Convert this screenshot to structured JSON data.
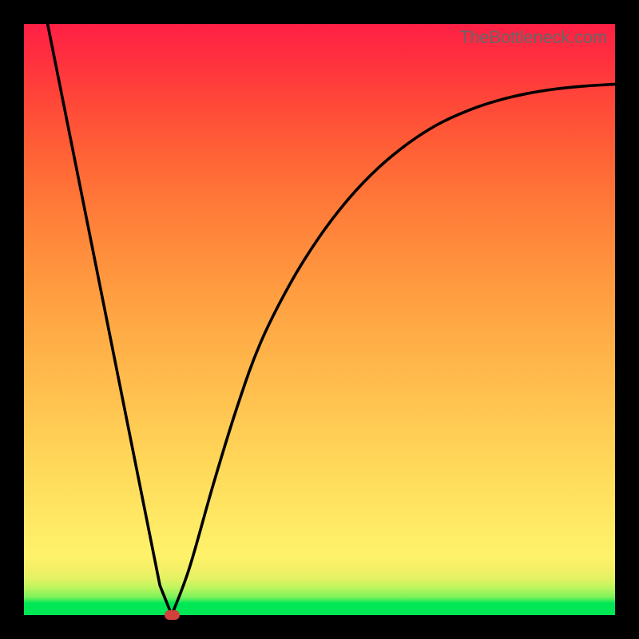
{
  "watermark": {
    "text": "TheBottleneck.com"
  },
  "colors": {
    "background": "#000000",
    "gradient_bottom": "#00e756",
    "gradient_top": "#ff2045",
    "curve_stroke": "#000000",
    "dot_fill": "#d1413e",
    "watermark_text": "#666666"
  },
  "chart_data": {
    "type": "line",
    "title": "",
    "xlabel": "",
    "ylabel": "",
    "xlim": [
      0,
      100
    ],
    "ylim": [
      0,
      100
    ],
    "annotations": [
      "TheBottleneck.com"
    ],
    "series": [
      {
        "name": "bottleneck-curve",
        "x": [
          4,
          8,
          12,
          16,
          20,
          23,
          25,
          28,
          32,
          36,
          40,
          45,
          50,
          55,
          60,
          65,
          70,
          75,
          80,
          85,
          90,
          95,
          100
        ],
        "values": [
          100,
          80,
          60,
          40,
          20,
          5,
          0,
          8,
          22,
          35,
          46,
          56,
          64,
          70.5,
          75.7,
          79.8,
          83,
          85.3,
          87,
          88.2,
          89,
          89.5,
          89.8
        ]
      }
    ],
    "minimum_point": {
      "x": 25,
      "y": 0
    }
  }
}
